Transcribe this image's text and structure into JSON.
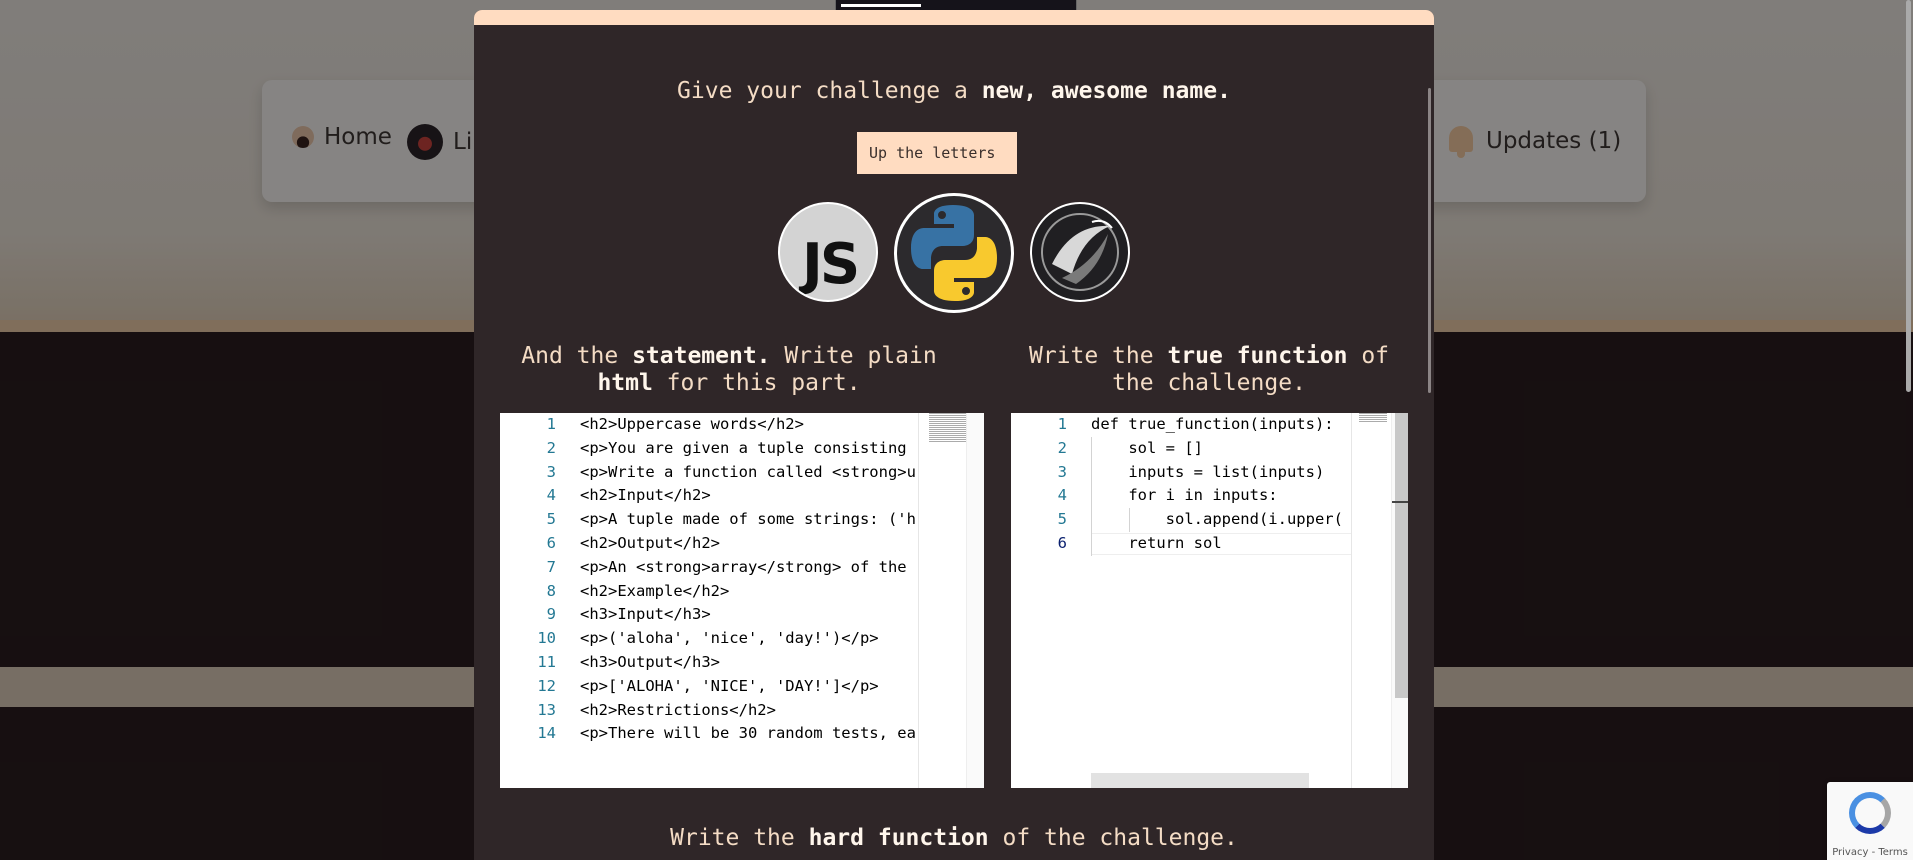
{
  "nav": {
    "home": "Home",
    "partial": "Li",
    "updates": "Updates (1)"
  },
  "modal": {
    "name_heading": {
      "pre": "Give your challenge a ",
      "bold": "new, awesome name."
    },
    "name_input": "Up the letters",
    "languages": [
      "JS",
      "python",
      "ocaml"
    ],
    "selected_language": "python",
    "statement_heading": {
      "pre": "And the ",
      "bold1": "statement.",
      "mid": " Write plain ",
      "bold2": "html",
      "post": " for this part."
    },
    "true_heading": {
      "pre": "Write the ",
      "bold": "true function",
      "post": " of the challenge."
    },
    "hard_heading": {
      "pre": "Write the ",
      "bold": "hard function",
      "post": " of the challenge."
    }
  },
  "statement_editor": {
    "lines": [
      {
        "n": "1",
        "code": "<h2>Uppercase words</h2>"
      },
      {
        "n": "2",
        "code": "<p>You are given a tuple consisting"
      },
      {
        "n": "3",
        "code": "<p>Write a function called <strong>u"
      },
      {
        "n": "4",
        "code": "<h2>Input</h2>"
      },
      {
        "n": "5",
        "code": "<p>A tuple made of some strings: ('h"
      },
      {
        "n": "6",
        "code": "<h2>Output</h2>"
      },
      {
        "n": "7",
        "code": "<p>An <strong>array</strong> of the"
      },
      {
        "n": "8",
        "code": "<h2>Example</h2>"
      },
      {
        "n": "9",
        "code": "<h3>Input</h3>"
      },
      {
        "n": "10",
        "code": "<p>('aloha', 'nice', 'day!')</p>"
      },
      {
        "n": "11",
        "code": "<h3>Output</h3>"
      },
      {
        "n": "12",
        "code": "<p>['ALOHA', 'NICE', 'DAY!']</p>"
      },
      {
        "n": "13",
        "code": "<h2>Restrictions</h2>"
      },
      {
        "n": "14",
        "code": "<p>There will be 30 random tests, ea"
      }
    ]
  },
  "true_editor": {
    "lines": [
      {
        "n": "1",
        "code": "def true_function(inputs):"
      },
      {
        "n": "2",
        "code": "    sol = []"
      },
      {
        "n": "3",
        "code": "    inputs = list(inputs)"
      },
      {
        "n": "4",
        "code": "    for i in inputs:"
      },
      {
        "n": "5",
        "code": "        sol.append(i.upper("
      },
      {
        "n": "6",
        "code": "    return sol"
      }
    ]
  },
  "recaptcha": {
    "links": "Privacy - Terms"
  },
  "colors": {
    "modal_bg": "#2f2628",
    "accent": "#ffdcc1",
    "heading_text": "#f4dcc5"
  }
}
